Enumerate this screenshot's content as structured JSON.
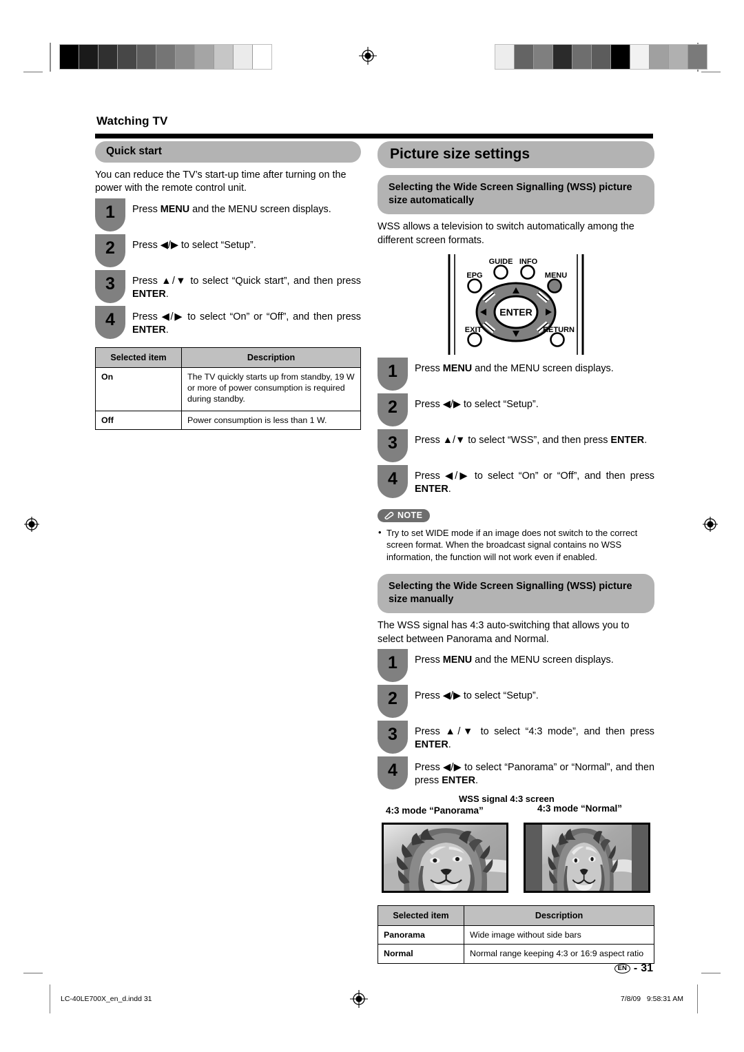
{
  "chapter": {
    "title": "Watching TV"
  },
  "left": {
    "quick_start": {
      "heading": "Quick start",
      "intro": "You can reduce the TV’s start-up time after turning on the power with the remote control unit.",
      "steps": [
        {
          "n": "1",
          "html": "Press <b>MENU</b> and the MENU screen displays."
        },
        {
          "n": "2",
          "html": "Press ◀/▶ to select “Setup”."
        },
        {
          "n": "3",
          "html": "Press ▲/▼ to select “Quick start”, and then press <b>ENTER</b>."
        },
        {
          "n": "4",
          "html": "Press ◀/▶ to select “On” or “Off”, and then press <b>ENTER</b>."
        }
      ],
      "table": {
        "headers": [
          "Selected item",
          "Description"
        ],
        "rows": [
          {
            "item": "On",
            "desc": "The TV quickly starts up from standby, 19 W or more of power consumption is required during standby."
          },
          {
            "item": "Off",
            "desc": "Power consumption is less than 1 W."
          }
        ]
      }
    }
  },
  "right": {
    "main_heading": "Picture size settings",
    "auto": {
      "heading": "Selecting the Wide Screen Signalling (WSS) picture size automatically",
      "intro": "WSS allows a television to switch automatically among the different screen formats.",
      "steps": [
        {
          "n": "1",
          "html": "Press <b>MENU</b> and the MENU screen displays."
        },
        {
          "n": "2",
          "html": "Press ◀/▶ to select “Setup”."
        },
        {
          "n": "3",
          "html": "Press ▲/▼ to select “WSS”, and then press <b>ENTER</b>."
        },
        {
          "n": "4",
          "html": "Press ◀/▶ to select “On” or “Off”, and then press <b>ENTER</b>."
        }
      ],
      "note_label": "NOTE",
      "notes": [
        "Try to set WIDE mode if an image does not switch to the correct screen format. When the broadcast signal contains no WSS information, the function will not work even if enabled."
      ]
    },
    "manual": {
      "heading": "Selecting the Wide Screen Signalling (WSS) picture size manually",
      "intro": "The WSS signal has 4:3 auto-switching that allows you to select between Panorama and Normal.",
      "steps": [
        {
          "n": "1",
          "html": "Press <b>MENU</b> and the MENU screen displays."
        },
        {
          "n": "2",
          "html": "Press ◀/▶ to select “Setup”."
        },
        {
          "n": "3",
          "html": "Press ▲/▼ to select “4:3 mode”, and then press <b>ENTER</b>."
        },
        {
          "n": "4",
          "html": "Press ◀/▶ to select “Panorama” or “Normal”, and then press <b>ENTER</b>."
        }
      ],
      "figure": {
        "top_caption": "WSS signal 4:3 screen",
        "panorama_caption": "4:3 mode “Panorama”",
        "normal_caption": "4:3 mode “Normal”"
      },
      "table": {
        "headers": [
          "Selected item",
          "Description"
        ],
        "rows": [
          {
            "item": "Panorama",
            "desc": "Wide image without side bars"
          },
          {
            "item": "Normal",
            "desc": "Normal range keeping 4:3 or 16:9 aspect ratio"
          }
        ]
      }
    }
  },
  "remote": {
    "buttons": [
      "GUIDE",
      "INFO",
      "EPG",
      "MENU",
      "EXIT",
      "RETURN",
      "ENTER"
    ]
  },
  "page_number": {
    "lang": "EN",
    "sep": "-",
    "number": "31"
  },
  "footer": {
    "file": "LC-40LE700X_en_d.indd   31",
    "date": "7/8/09   9:58:31 AM"
  },
  "marks": {
    "bar_left_swatches": [
      "#000000",
      "#1a1a1a",
      "#303030",
      "#474747",
      "#5e5e5e",
      "#757575",
      "#8d8d8d",
      "#a5a5a5",
      "#c6c6c6",
      "#ebebeb",
      "#ffffff"
    ],
    "bar_right_swatches": [
      "#ededed",
      "#646464",
      "#7f7f7f",
      "#2b2b2b",
      "#6e6e6e",
      "#5c5c5c",
      "#000000",
      "#f2f2f2",
      "#a0a0a0",
      "#b0b0b0",
      "#7a7a7a"
    ]
  }
}
